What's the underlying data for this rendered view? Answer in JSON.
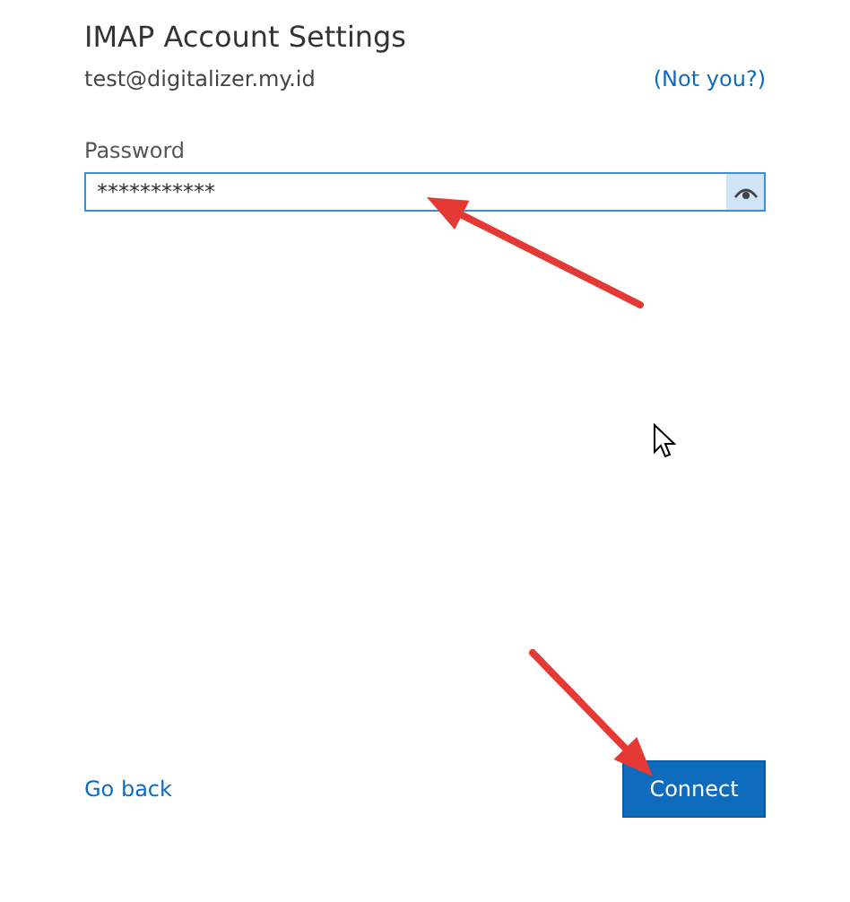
{
  "title": "IMAP Account Settings",
  "account": {
    "email": "test@digitalizer.my.id",
    "switch_link": "(Not you?)"
  },
  "password": {
    "label": "Password",
    "value": "***********",
    "focused": true
  },
  "back_link": "Go back",
  "connect_button": "Connect"
}
